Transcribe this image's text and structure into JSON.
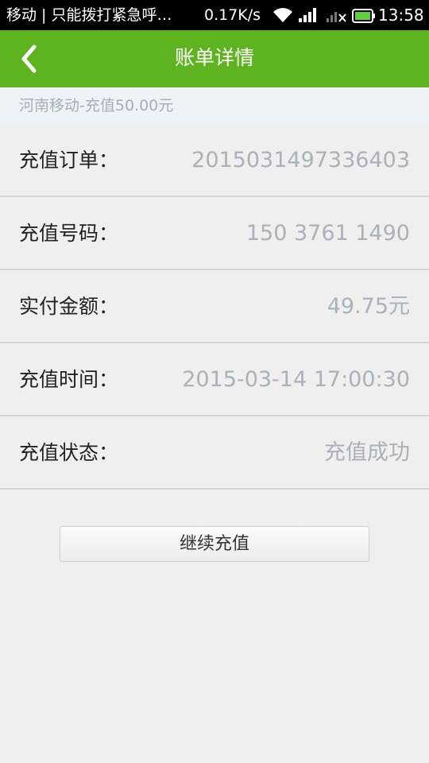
{
  "status_bar": {
    "carrier": "移动 | 只能拨打紧急呼…",
    "network_speed": "0.17K/s",
    "time": "13:58"
  },
  "header": {
    "title": "账单详情"
  },
  "summary": "河南移动-充值50.00元",
  "details": [
    {
      "label": "充值订单：",
      "value": "2015031497336403"
    },
    {
      "label": "充值号码：",
      "value": "150 3761 1490"
    },
    {
      "label": "实付金额：",
      "value": "49.75元"
    },
    {
      "label": "充值时间：",
      "value": "2015-03-14 17:00:30"
    },
    {
      "label": "充值状态：",
      "value": "充值成功"
    }
  ],
  "actions": {
    "continue_label": "继续充值"
  },
  "colors": {
    "accent": "#5db41f",
    "value_text": "#aab1b9",
    "summary_bg": "#eef3f8"
  }
}
